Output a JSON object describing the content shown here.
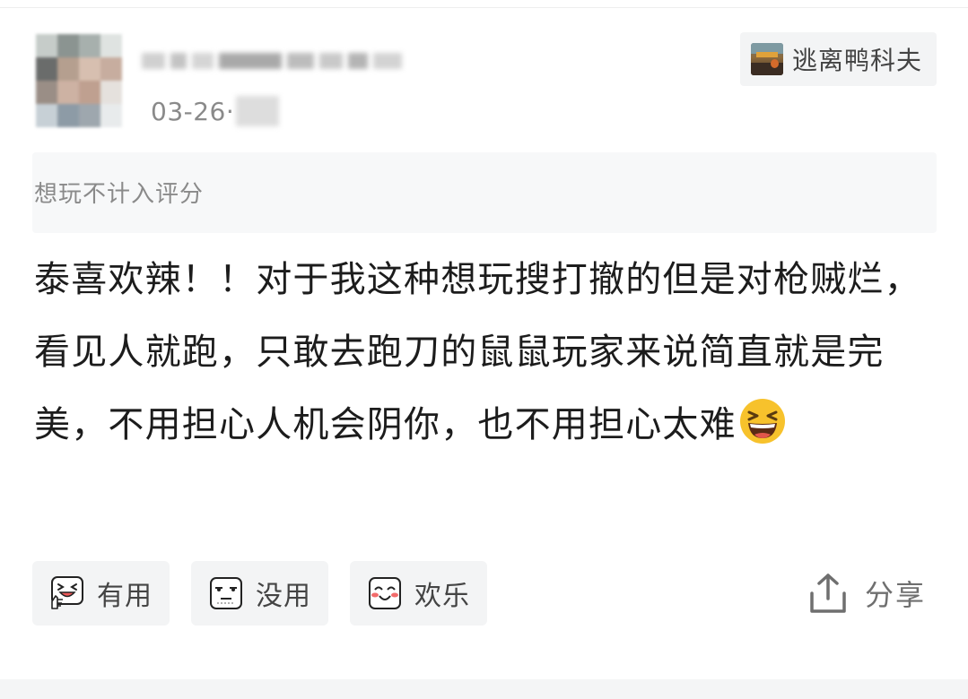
{
  "post": {
    "date": "03-26",
    "date_separator": "·",
    "game_tag": {
      "name": "逃离鸭科夫",
      "icon": "game-cover-thumbnail"
    },
    "rating_note": "想玩不计入评分",
    "content": "泰喜欢辣！！对于我这种想玩搜打撤的但是对枪贼烂，看见人就跑，只敢去跑刀的鼠鼠玩家来说简直就是完美，不用担心人机会阴你，也不用担心太难",
    "trailing_emoji": "grinning-squinting-face-emoji"
  },
  "reactions": [
    {
      "label": "有用",
      "icon": "laughing-thumbs-up-icon"
    },
    {
      "label": "没用",
      "icon": "unimpressed-face-icon"
    },
    {
      "label": "欢乐",
      "icon": "blushing-smile-icon"
    }
  ],
  "share": {
    "label": "分享",
    "icon": "share-upload-icon"
  },
  "colors": {
    "chip_background": "#f3f4f5",
    "secondary_text": "#8a8a8a",
    "body_text": "#1c1c1c"
  }
}
